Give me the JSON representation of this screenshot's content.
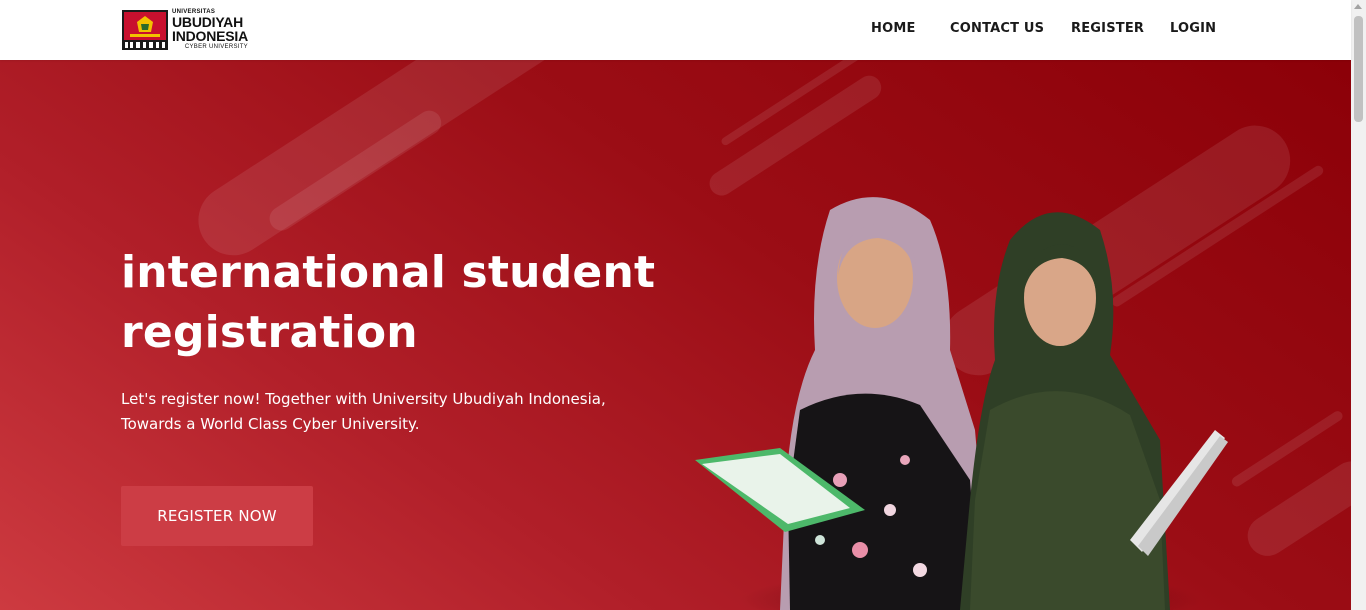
{
  "brand": {
    "top": "UNIVERSITAS",
    "line1": "UBUDIYAH",
    "line2": "INDONESIA",
    "tagline": "CYBER UNIVERSITY",
    "icon": "university-crest-icon"
  },
  "nav": {
    "items": [
      {
        "label": "HOME"
      },
      {
        "label": "CONTACT US"
      },
      {
        "label": "REGISTER"
      },
      {
        "label": "LOGIN"
      }
    ]
  },
  "hero": {
    "title": "international student registration",
    "subtitle": "Let's register now! Together with University Ubudiyah Indonesia, Towards a World Class Cyber University.",
    "cta": "REGISTER NOW"
  },
  "colors": {
    "hero_start": "#cd3a40",
    "hero_end": "#8c0008",
    "cta": "#cc3d45",
    "nav_text": "#1a1a1a"
  }
}
